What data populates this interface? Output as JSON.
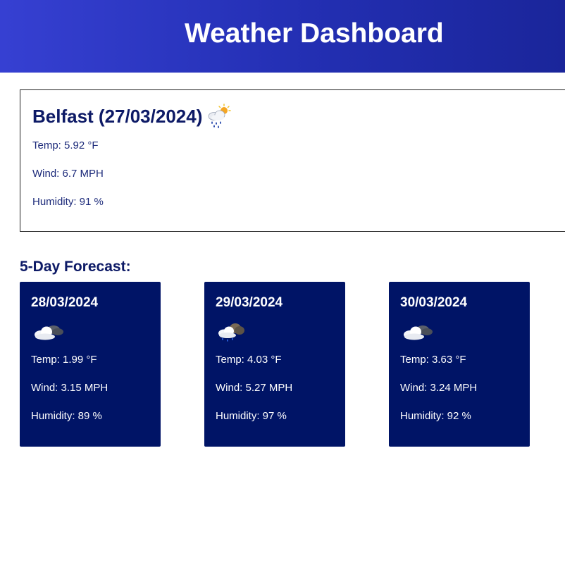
{
  "header": {
    "title": "Weather Dashboard"
  },
  "current": {
    "city_date": "Belfast (27/03/2024)",
    "icon": "rain-sun-cloud-icon",
    "temp": "Temp: 5.92 °F",
    "wind": "Wind: 6.7 MPH",
    "humidity": "Humidity: 91 %"
  },
  "forecast": {
    "title": "5-Day Forecast:",
    "days": [
      {
        "date": "28/03/2024",
        "icon": "broken-clouds-icon",
        "temp": "Temp: 1.99 °F",
        "wind": "Wind: 3.15 MPH",
        "humidity": "Humidity: 89 %"
      },
      {
        "date": "29/03/2024",
        "icon": "rain-cloud-icon",
        "temp": "Temp: 4.03 °F",
        "wind": "Wind: 5.27 MPH",
        "humidity": "Humidity: 97 %"
      },
      {
        "date": "30/03/2024",
        "icon": "broken-clouds-icon",
        "temp": "Temp: 3.63 °F",
        "wind": "Wind: 3.24 MPH",
        "humidity": "Humidity: 92 %"
      }
    ]
  },
  "colors": {
    "header_gradient_start": "#3640d2",
    "header_gradient_end": "#1a259a",
    "card_background": "#001466",
    "title_text": "#0d1a66"
  }
}
